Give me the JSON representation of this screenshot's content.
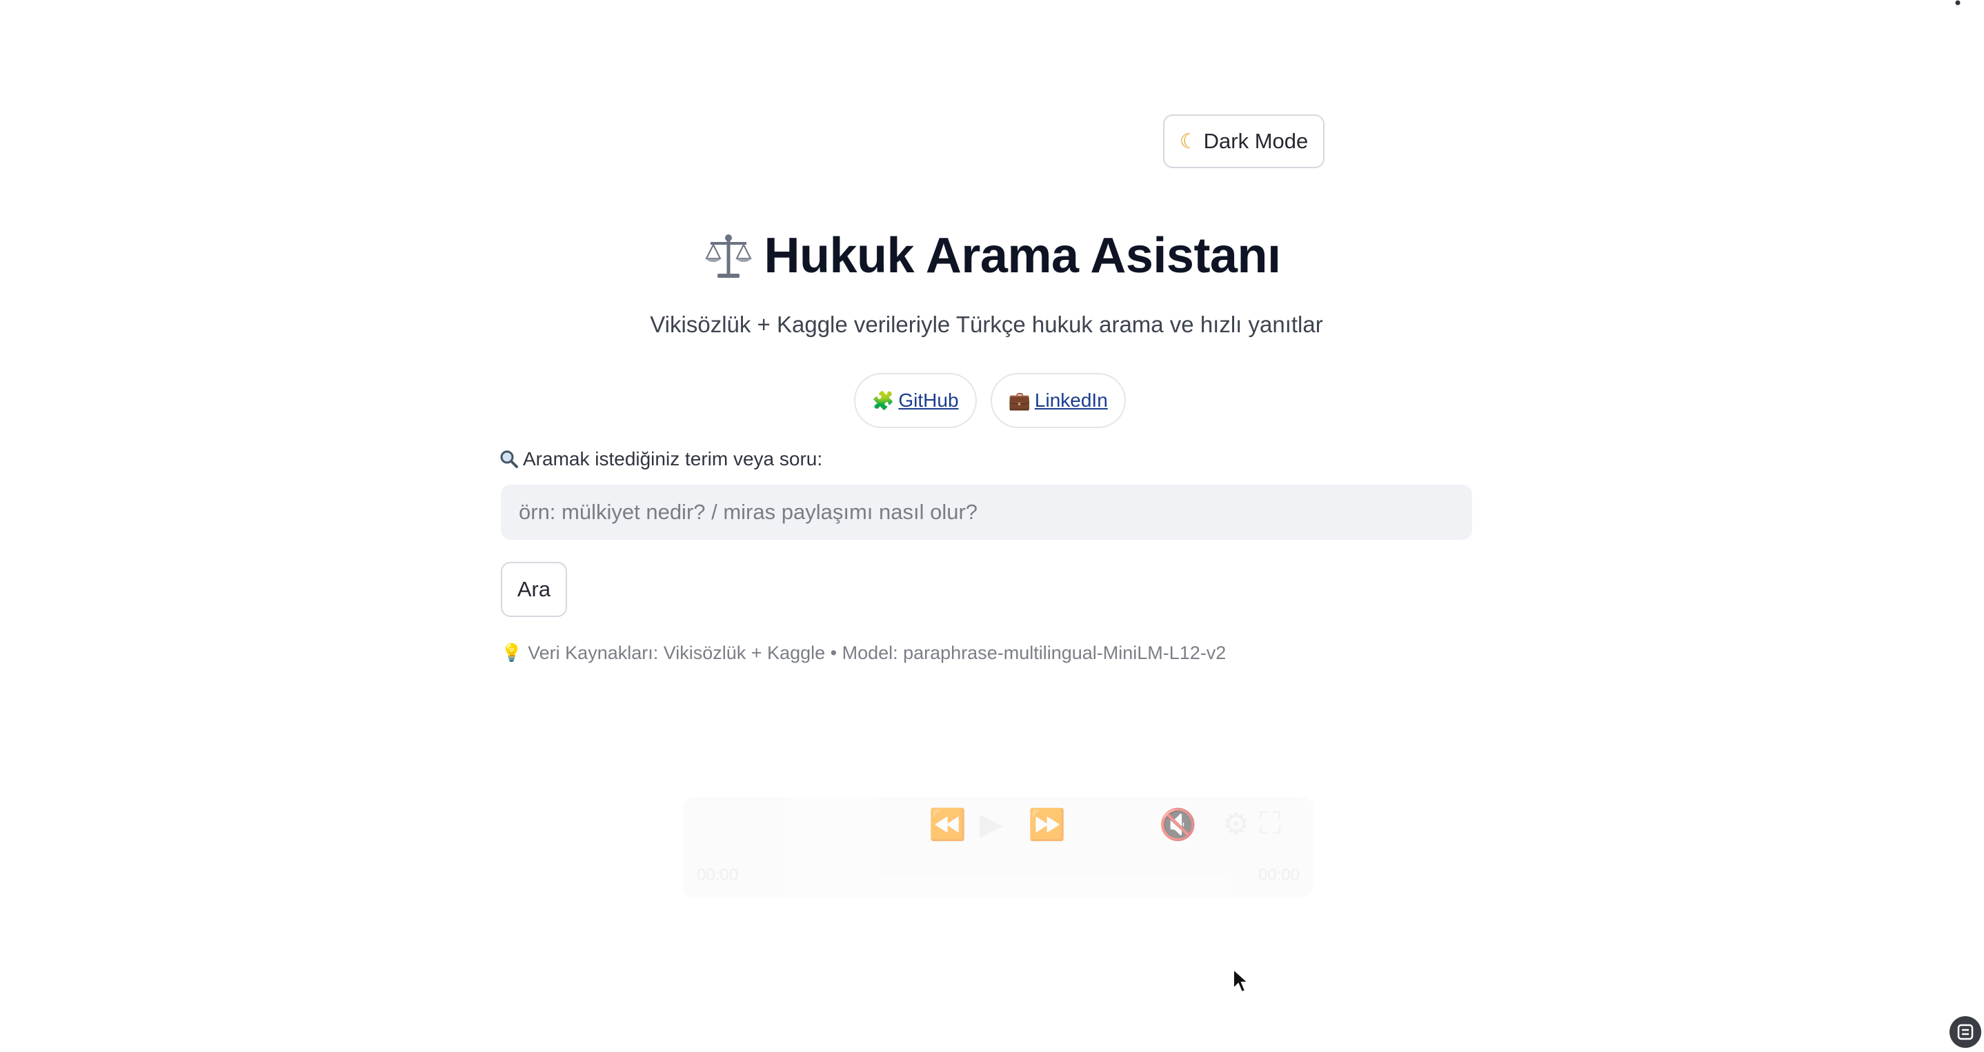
{
  "header": {
    "menu_icon": "kebab-menu-icon",
    "dark_mode": {
      "icon": "moon-icon",
      "label": "Dark Mode"
    }
  },
  "hero": {
    "title_icon": "scales-icon",
    "title": "Hukuk Arama Asistanı",
    "subtitle": "Vikisözlük + Kaggle verileriyle Türkçe hukuk arama ve hızlı yanıtlar"
  },
  "links": [
    {
      "icon": "puzzle-icon",
      "label": "GitHub"
    },
    {
      "icon": "briefcase-icon",
      "label": "LinkedIn"
    }
  ],
  "search": {
    "label_icon": "magnifier-icon",
    "label": "Aramak istediğiniz terim veya soru:",
    "value": "",
    "placeholder": "örn: mülkiyet nedir? / miras paylaşımı nasıl olur?",
    "button_label": "Ara"
  },
  "footer_info": {
    "icon": "lightbulb-icon",
    "text": "Veri Kaynakları: Vikisözlük + Kaggle • Model: paraphrase-multilingual-MiniLM-L12-v2"
  },
  "player": {
    "current_time": "00:00",
    "total_time": "00:00"
  },
  "colors": {
    "title": "#0f1424",
    "link": "#1a3c8f",
    "input_bg": "#f0f2f6",
    "border": "#d5d8de"
  }
}
